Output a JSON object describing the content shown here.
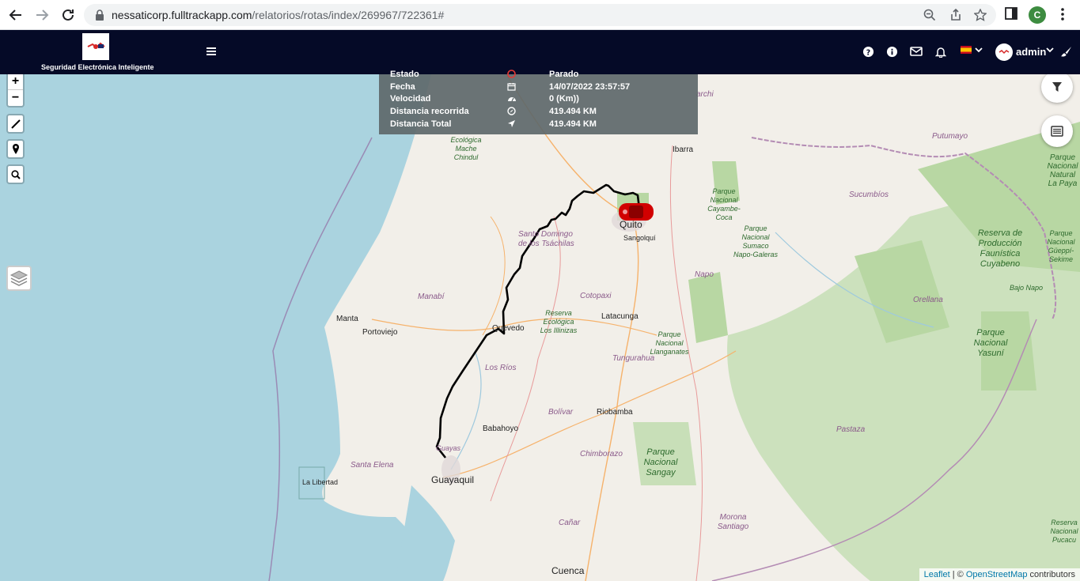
{
  "browser": {
    "url_domain": "nessaticorp.fulltrackapp.com",
    "url_path": "/relatorios/rotas/index/269967/722361#",
    "profile_initial": "C"
  },
  "header": {
    "brand_text": "Seguridad Electrónica Inteligente",
    "user_label": "admin",
    "language_flag": "es"
  },
  "info_panel": {
    "rows": [
      {
        "label": "Estado",
        "value": "Parado",
        "icon": "stop-icon"
      },
      {
        "label": "Fecha",
        "value": "14/07/2022 23:57:57",
        "icon": "calendar-icon"
      },
      {
        "label": "Velocidad",
        "value": "0 (Km))",
        "icon": "speedometer-icon"
      },
      {
        "label": "Distancia recorrida",
        "value": "419.494 KM",
        "icon": "compass-icon"
      },
      {
        "label": "Distancia Total",
        "value": "419.494 KM",
        "icon": "location-arrow-icon"
      }
    ]
  },
  "map": {
    "zoom_in": "+",
    "zoom_out": "−",
    "labels": {
      "quito": "Quito",
      "guayaquil": "Guayaquil",
      "cuenca": "Cuenca",
      "ibarra": "Ibarra",
      "sangolqui": "Sangolquí",
      "latacunga": "Latacunga",
      "riobamba": "Riobamba",
      "babahoyo": "Babahoyo",
      "quevedo": "Quevedo",
      "manta": "Manta",
      "portoviejo": "Portoviejo",
      "la_libertad": "La Libertad",
      "santo_domingo": "Santo Domingo de los Tsáchilas",
      "manabi": "Manabí",
      "los_rios": "Los Ríos",
      "bolivar": "Bolívar",
      "cotopaxi": "Cotopaxi",
      "tungurahua": "Tungurahua",
      "chimborazo": "Chimborazo",
      "santa_elena": "Santa Elena",
      "guayas": "Guayas",
      "canar": "Cañar",
      "napo": "Napo",
      "pastaza": "Pastaza",
      "orellana": "Orellana",
      "sucumbios": "Sucumbíos",
      "putumayo": "Putumayo",
      "morona": "Morona Santiago",
      "imbabura": "archi",
      "park_cayambe": "Parque Nacional Cayambe-Coca",
      "park_sumaco": "Parque Nacional Sumaco Napo-Galeras",
      "park_llanganates": "Parque Nacional Llanganates",
      "park_sangay": "Parque Nacional Sangay",
      "park_yasuni": "Parque Nacional Yasuní",
      "res_cuyabeno": "Reserva de Producción Faunística Cuyabeno",
      "res_illinizas": "Reserva Ecológica Los Illinizas",
      "res_mache": "Ecológica Mache Chindul",
      "park_natural": "Parque Nacional Natural La Paya",
      "park_gueppi": "Parque Nacional Güeppí-Sekime",
      "bajo_napo": "Bajo Napo",
      "res_pucacu": "Reserva Nacional Pucacu"
    }
  },
  "attribution": {
    "leaflet": "Leaflet",
    "separator": " | © ",
    "osm": "OpenStreetMap",
    "contributors": " contributors"
  }
}
